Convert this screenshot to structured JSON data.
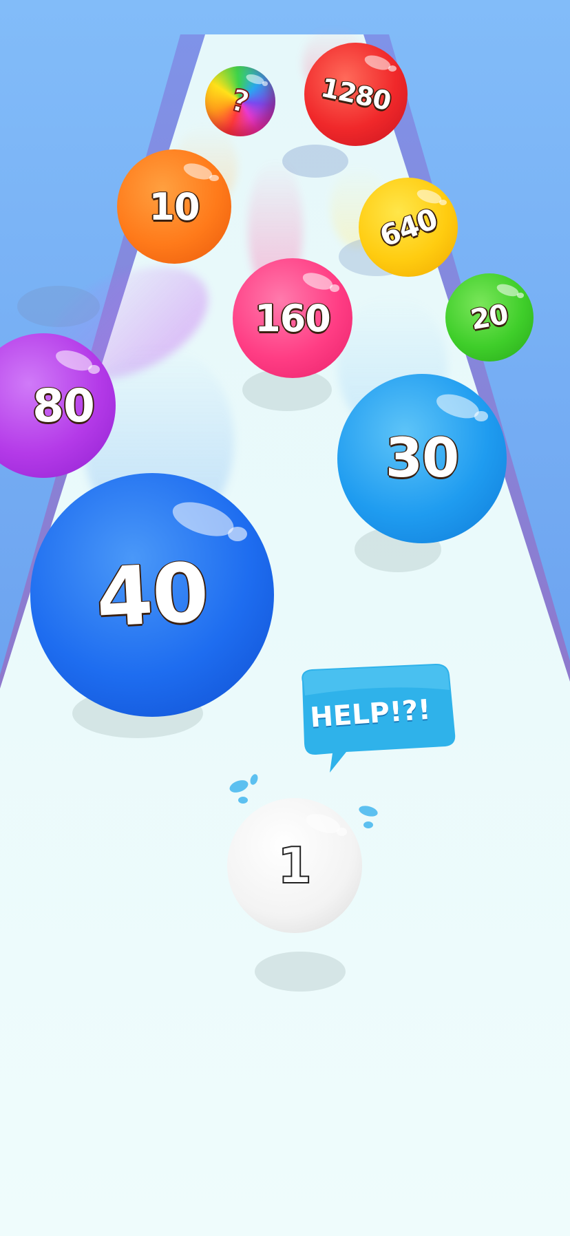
{
  "game": {
    "player_ball_value": "1",
    "speech_bubble_text": "HELP!?!",
    "mystery_ball_symbol": "?"
  },
  "balls": [
    {
      "value": "1280",
      "color": "#f02a2a"
    },
    {
      "value": "10",
      "color": "#ff7a1a"
    },
    {
      "value": "640",
      "color": "#ffcc10"
    },
    {
      "value": "160",
      "color": "#ff3d84"
    },
    {
      "value": "20",
      "color": "#3fce2a"
    },
    {
      "value": "80",
      "color": "#b43ae8"
    },
    {
      "value": "30",
      "color": "#1f9cf0"
    },
    {
      "value": "40",
      "color": "#1e6df0"
    }
  ],
  "colors": {
    "sky_top": "#7fb8f8",
    "sky_bottom": "#5f95ee",
    "track": "#eefbfb",
    "track_edge": "#8a7fd4",
    "bubble": "#2fb2ea"
  }
}
